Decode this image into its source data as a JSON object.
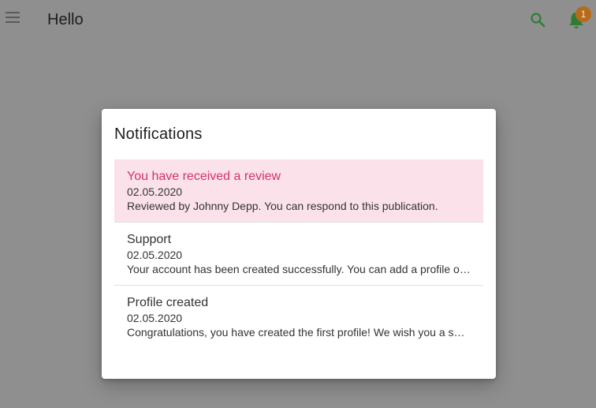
{
  "app_bar": {
    "title": "Hello",
    "menu_icon": "menu-icon",
    "search_icon": "search-icon",
    "bell_icon": "bell-icon",
    "notification_count": "1",
    "accent_color": "#2e7d32",
    "badge_color": "#b86a1b"
  },
  "dialog": {
    "title": "Notifications",
    "items": [
      {
        "title": "You have received a review",
        "date": "02.05.2020",
        "body": "Reviewed by Johnny Depp. You can respond to this publication."
      },
      {
        "title": "Support",
        "date": "02.05.2020",
        "body": "Your account has been created successfully. You can add a profile of your choice."
      },
      {
        "title": "Profile created",
        "date": "02.05.2020",
        "body": "Congratulations, you have created the first profile! We wish you a successful experience."
      }
    ],
    "highlight_color": "#fbe2ea",
    "highlight_title_color": "#d6306c"
  }
}
